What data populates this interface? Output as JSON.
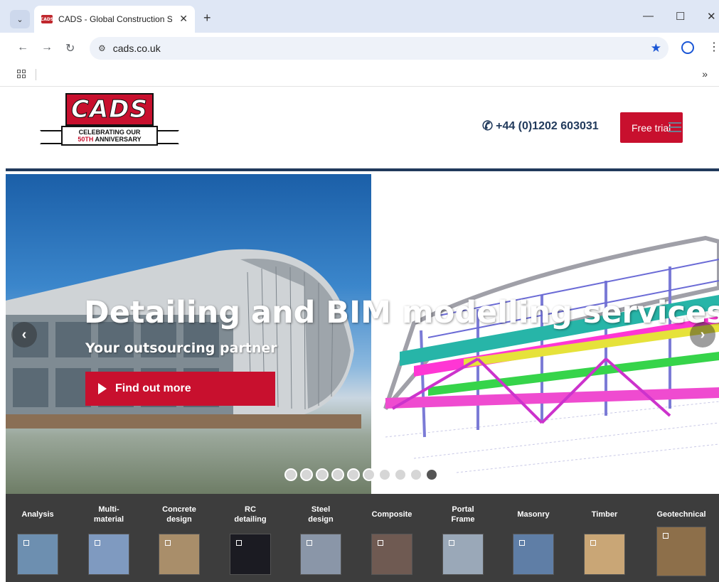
{
  "browser": {
    "tab_title": "CADS - Global Construction Software",
    "favicon_text": "CADS",
    "new_tab_symbol": "+",
    "tab_close_symbol": "✕",
    "tab_list_symbol": "⌄",
    "url": "cads.co.uk",
    "window_controls": {
      "minimize": "—",
      "maximize": "☐",
      "close": "✕"
    },
    "nav": {
      "back": "←",
      "forward": "→",
      "reload": "↻"
    },
    "site_info_icon": "⚙",
    "bookmark_star": "★",
    "menu_dots": "⋮",
    "bookmarks_more": "»"
  },
  "header": {
    "logo_text": "CADS",
    "logo_banner_line1": "CELEBRATING OUR",
    "logo_banner_line2_highlight": "50TH",
    "logo_banner_line2_rest": " ANNIVERSARY",
    "phone_icon": "✆",
    "phone": "+44 (0)1202 603031",
    "cta_label": "Free trial"
  },
  "hero": {
    "title": "Detailing and BIM modelling services",
    "subtitle": "Your outsourcing partner",
    "cta_label": "Find out more",
    "prev_arrow": "‹",
    "next_arrow": "›",
    "slide_count": 10,
    "active_slide": 10
  },
  "categories": [
    {
      "label": "Analysis",
      "thumb_color": "#6d8fb0"
    },
    {
      "label": "Multi-\nmaterial",
      "thumb_color": "#7f9ac0"
    },
    {
      "label": "Concrete\ndesign",
      "thumb_color": "#a98e6a"
    },
    {
      "label": "RC\ndetailing",
      "thumb_color": "#1b1b22"
    },
    {
      "label": "Steel\ndesign",
      "thumb_color": "#8a96a8"
    },
    {
      "label": "Composite",
      "thumb_color": "#6f5a52"
    },
    {
      "label": "Portal\nFrame",
      "thumb_color": "#9aa8b8"
    },
    {
      "label": "Masonry",
      "thumb_color": "#5f7ea6"
    },
    {
      "label": "Timber",
      "thumb_color": "#c9a676"
    },
    {
      "label": "Geotechnical",
      "thumb_color": "#8d6f4a"
    }
  ]
}
